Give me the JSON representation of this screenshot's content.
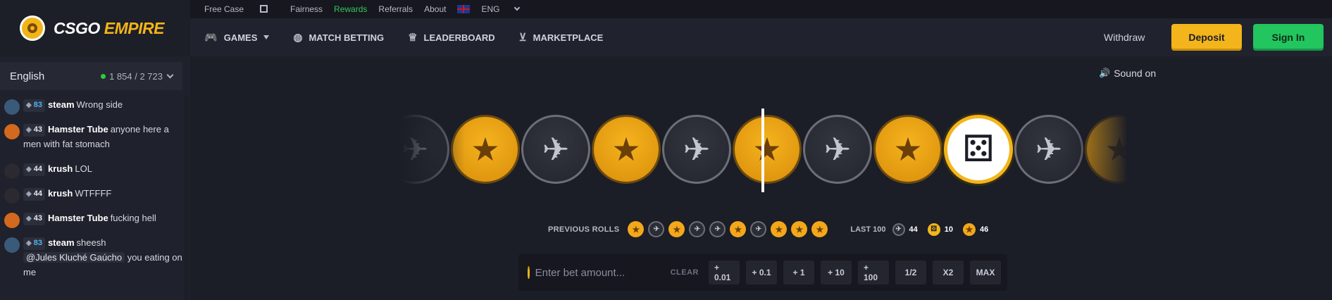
{
  "brand": {
    "name_white": "CSGO",
    "name_yellow": "EMPIRE",
    "colors": {
      "yellow": "#f3b51b",
      "green": "#22c55e",
      "background": "#1b1d27"
    }
  },
  "topbar": {
    "links": [
      {
        "label": "Free Case",
        "icon": "gift-icon"
      },
      {
        "label": "Fairness"
      },
      {
        "label": "Rewards"
      },
      {
        "label": "Referrals"
      },
      {
        "label": "About"
      }
    ],
    "language": "ENG"
  },
  "nav": {
    "items": [
      {
        "label": "GAMES",
        "icon": "gamepad-icon"
      },
      {
        "label": "MATCH BETTING",
        "icon": "globe-icon"
      },
      {
        "label": "LEADERBOARD",
        "icon": "trophy-icon"
      },
      {
        "label": "MARKETPLACE",
        "icon": "cart-icon"
      }
    ],
    "withdraw": "Withdraw",
    "deposit": "Deposit",
    "sign_in": "Sign In"
  },
  "chat": {
    "language": "English",
    "online": "1 854 / 2 723",
    "messages": [
      {
        "level": "83",
        "user": "steam",
        "text": "Wrong side"
      },
      {
        "level": "43",
        "user": "Hamster Tube",
        "text": "anyone here a men with fat stomach"
      },
      {
        "level": "44",
        "user": "krush",
        "text": "LOL"
      },
      {
        "level": "44",
        "user": "krush",
        "text": "WTFFFF"
      },
      {
        "level": "43",
        "user": "Hamster Tube",
        "text": "fucking hell"
      },
      {
        "level": "83",
        "user": "steam",
        "text": "sheesh",
        "mention": "@Jules Kluché Gaúcho",
        "text2": "you eating on me"
      }
    ]
  },
  "game": {
    "sound": "Sound on",
    "roller": [
      "ct",
      "t",
      "ct",
      "t",
      "ct",
      "t",
      "ct",
      "t",
      "dice",
      "ct",
      "t"
    ],
    "previous_label": "PREVIOUS ROLLS",
    "previous_rolls": [
      "t",
      "ct",
      "t",
      "ct",
      "ct",
      "t",
      "ct",
      "t",
      "t",
      "t"
    ],
    "last100_label": "LAST 100",
    "last100": {
      "ct": "44",
      "bonus": "10",
      "t": "46"
    }
  },
  "bet": {
    "placeholder": "Enter bet amount...",
    "clear": "CLEAR",
    "buttons": [
      "+ 0.01",
      "+ 0.1",
      "+ 1",
      "+ 10",
      "+ 100",
      "1/2",
      "X2",
      "MAX"
    ]
  }
}
